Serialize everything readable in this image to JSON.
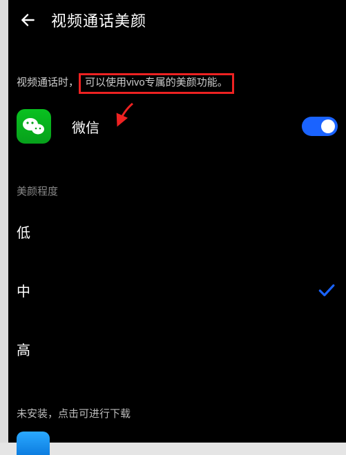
{
  "header": {
    "title": "视频通话美颜"
  },
  "description": {
    "prefix": "视频通话时，",
    "highlight": "可以使用vivo专属的美颜功能。"
  },
  "app": {
    "name": "微信",
    "icon_name": "wechat-icon",
    "enabled": true
  },
  "beauty": {
    "section_label": "美颜程度",
    "levels": [
      {
        "label": "低",
        "selected": false
      },
      {
        "label": "中",
        "selected": true
      },
      {
        "label": "高",
        "selected": false
      }
    ]
  },
  "not_installed_hint": "未安装，点击可进行下载"
}
